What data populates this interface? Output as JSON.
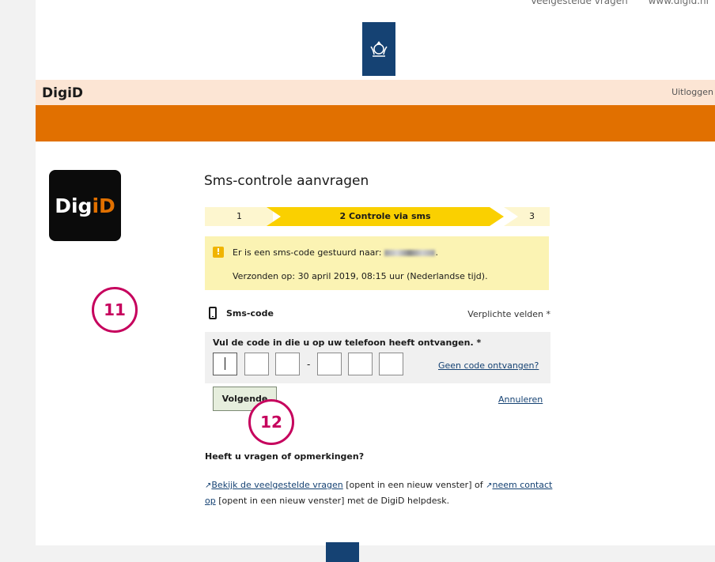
{
  "top_links": [
    "Veelgestelde vragen",
    "www.digid.nl"
  ],
  "header": {
    "brand": "DigiD",
    "logout": "Uitloggen"
  },
  "app_icon": {
    "text_main": "Dig",
    "text_accent": "iD"
  },
  "page": {
    "title": "Sms-controle aanvragen"
  },
  "steps": [
    {
      "label": "1",
      "active": false
    },
    {
      "label": "2 Controle via sms",
      "active": true
    },
    {
      "label": "3",
      "active": false
    }
  ],
  "alert": {
    "line1": "Er is een sms-code gestuurd naar:",
    "line2": "Verzonden op: 30 april 2019, 08:15 uur (Nederlandse tijd)."
  },
  "sms": {
    "label": "Sms-code",
    "required_note": "Verplichte velden *"
  },
  "code": {
    "label": "Vul de code in die u op uw telefoon heeft ontvangen. *",
    "separator": "-",
    "no_code_link": "Geen code ontvangen?"
  },
  "actions": {
    "next_label": "Volgende",
    "cancel_label": "Annuleren"
  },
  "help": {
    "title": "Heeft u vragen of opmerkingen?",
    "link1": "Bekijk de veelgestelde vragen",
    "new_window": "[opent in een nieuw venster]",
    "or": "of",
    "link2_part1": "neem contact",
    "link2_part2": "op",
    "helpdesk": "met de DigiD helpdesk."
  },
  "callouts": [
    "11",
    "12"
  ],
  "colors": {
    "orange": "#e17000",
    "navy": "#154273",
    "step_active": "#fad000",
    "callout": "#c6005d"
  }
}
